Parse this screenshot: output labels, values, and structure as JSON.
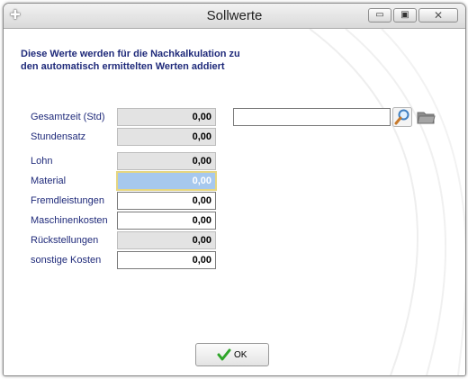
{
  "window": {
    "title": "Sollwerte",
    "minimize_glyph": "▭",
    "maximize_glyph": "▣",
    "close_glyph": "✕"
  },
  "heading": {
    "line1": "Diese Werte werden für die Nachkalkulation zu",
    "line2": "den automatisch ermittelten Werten addiert"
  },
  "fields": [
    {
      "label": "Gesamtzeit (Std)",
      "value": "0,00",
      "readonly": true
    },
    {
      "label": "Stundensatz",
      "value": "0,00",
      "readonly": true
    },
    {
      "label": "Lohn",
      "value": "0,00",
      "readonly": true
    },
    {
      "label": "Material",
      "value": "0,00",
      "readonly": false,
      "focused": true
    },
    {
      "label": "Fremdleistungen",
      "value": "0,00",
      "readonly": false
    },
    {
      "label": "Maschinenkosten",
      "value": "0,00",
      "readonly": false
    },
    {
      "label": "Rückstellungen",
      "value": "0,00",
      "readonly": true
    },
    {
      "label": "sonstige Kosten",
      "value": "0,00",
      "readonly": false
    }
  ],
  "search": {
    "value": ""
  },
  "icons": {
    "search": "magnifier-icon",
    "folder": "folder-icon",
    "ok": "check-icon",
    "app": "app-icon"
  },
  "ok_button": {
    "label": "OK"
  },
  "colors": {
    "label": "#1f2a7a",
    "readonly_bg": "#e3e3e3",
    "focus_bg": "#a6c8ee",
    "ok_check": "#2fa52a"
  }
}
